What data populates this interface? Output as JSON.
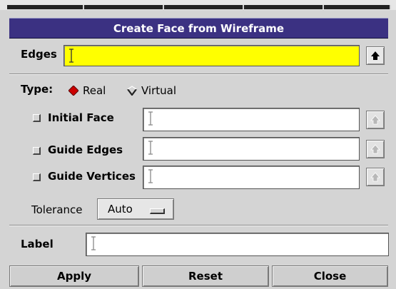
{
  "dialog": {
    "title": "Create Face from Wireframe"
  },
  "edges": {
    "label": "Edges",
    "value": ""
  },
  "type": {
    "label": "Type:",
    "options": [
      "Real",
      "Virtual"
    ],
    "selected": "Real"
  },
  "rows": [
    {
      "label": "Initial Face",
      "value": ""
    },
    {
      "label": "Guide Edges",
      "value": ""
    },
    {
      "label": "Guide Vertices",
      "value": ""
    }
  ],
  "tolerance": {
    "label": "Tolerance",
    "value": "Auto"
  },
  "label_field": {
    "label": "Label",
    "value": ""
  },
  "buttons": {
    "apply": "Apply",
    "reset": "Reset",
    "close": "Close"
  },
  "colors": {
    "title_bg": "#3b3182",
    "active_field": "#ffff00",
    "radio_selected": "#cc0000"
  }
}
